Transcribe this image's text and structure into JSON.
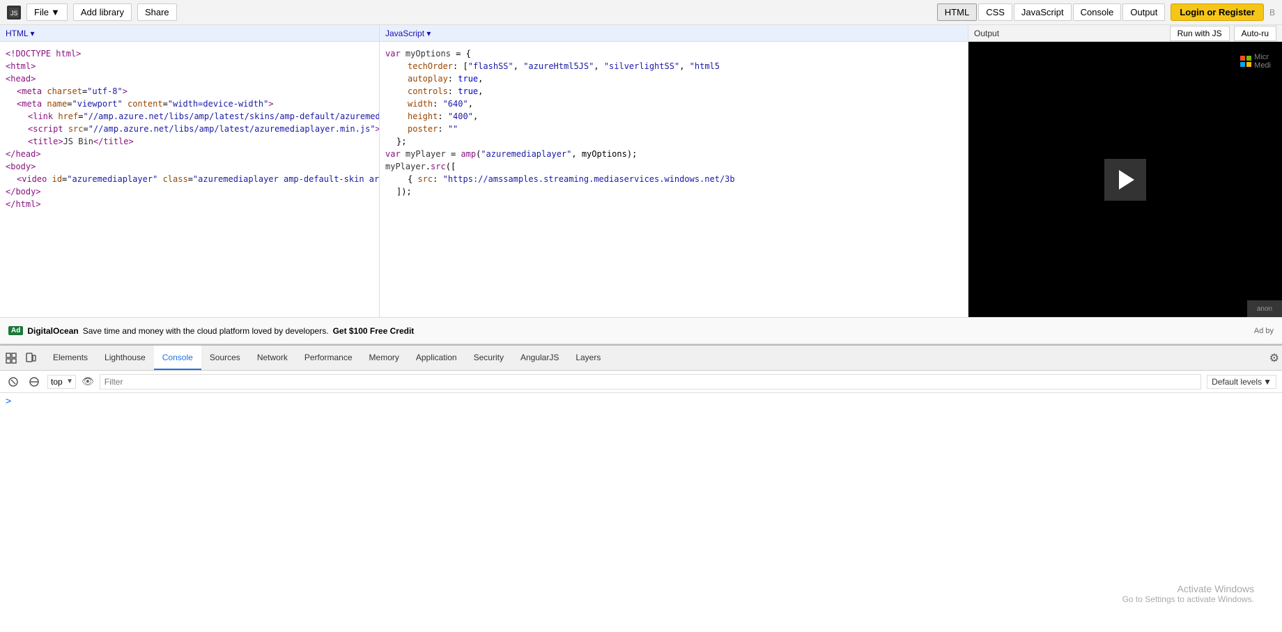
{
  "topbar": {
    "file_label": "File",
    "add_library_label": "Add library",
    "share_label": "Share",
    "tabs": [
      "HTML",
      "CSS",
      "JavaScript",
      "Console",
      "Output"
    ],
    "active_tab": "HTML",
    "login_label": "Login or Register",
    "auto_run_label": "Auto-ru"
  },
  "html_panel": {
    "header_label": "HTML ▾",
    "lines": [
      "<!DOCTYPE html>",
      "<html>",
      "<head>",
      "    <meta charset=\"utf-8\">",
      "    <meta name=\"viewport\" content=\"width=device-width\">",
      "    <link href=\"//amp.azure.net/libs/amp/latest/skins/amp-default/azuremed",
      "    <script src=\"//amp.azure.net/libs/amp/latest/azuremediaplayer.min.js\"><",
      "    <title>JS Bin</title>",
      "</head>",
      "<body>",
      "    <video id=\"azuremediaplayer\" class=\"azuremediaplayer amp-default-skin ar",
      "</body>",
      "</html>"
    ]
  },
  "js_panel": {
    "header_label": "JavaScript ▾",
    "lines": [
      "var myOptions = {",
      "        techOrder: [\"flashSS\", \"azureHtml5JS\", \"silverlightSS\", \"html5",
      "        autoplay: true,",
      "        controls: true,",
      "        width: \"640\",",
      "        height: \"400\",",
      "        poster: \"\"",
      "    };",
      "var myPlayer = amp(\"azuremediaplayer\", myOptions);",
      "myPlayer.src([",
      "        { src: \"https://amssamples.streaming.mediaservices.windows.net/3b",
      "    ]);"
    ]
  },
  "output_panel": {
    "header_label": "Output",
    "run_with_js_label": "Run with JS",
    "auto_run_label": "Auto-ru",
    "watermark_line1": "Micr",
    "watermark_line2": "Medi"
  },
  "ad_bar": {
    "badge": "Ad",
    "brand": "DigitalOcean",
    "text": "Save time and money with the cloud platform loved by developers.",
    "cta": "Get $100 Free Credit",
    "right_text": "Ad by"
  },
  "devtools": {
    "tabs": [
      {
        "label": "Elements",
        "active": false
      },
      {
        "label": "Lighthouse",
        "active": false
      },
      {
        "label": "Console",
        "active": true
      },
      {
        "label": "Sources",
        "active": false
      },
      {
        "label": "Network",
        "active": false
      },
      {
        "label": "Performance",
        "active": false
      },
      {
        "label": "Memory",
        "active": false
      },
      {
        "label": "Application",
        "active": false
      },
      {
        "label": "Security",
        "active": false
      },
      {
        "label": "AngularJS",
        "active": false
      },
      {
        "label": "Layers",
        "active": false
      }
    ],
    "console": {
      "context": "top",
      "filter_placeholder": "Filter",
      "levels": "Default levels"
    }
  },
  "watermark": {
    "activate_windows": "Activate Windows",
    "activate_msg": "Go to Settings to activate Windows."
  }
}
